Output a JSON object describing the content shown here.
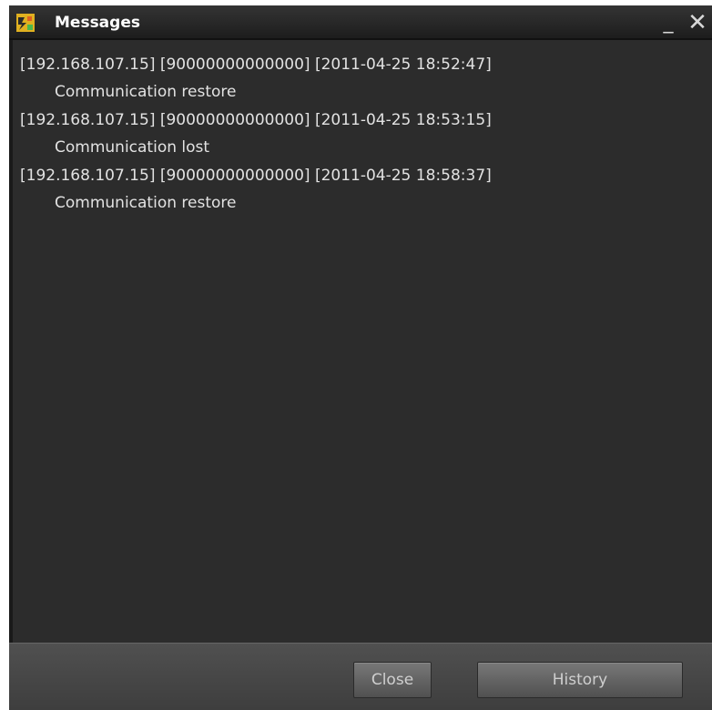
{
  "window": {
    "title": "Messages",
    "minimize_glyph": "_",
    "close_glyph": "✕",
    "icon": "app-icon"
  },
  "messages": [
    {
      "header": "[192.168.107.15] [90000000000000] [2011-04-25 18:52:47]",
      "text": "Communication restore"
    },
    {
      "header": "[192.168.107.15] [90000000000000] [2011-04-25 18:53:15]",
      "text": "Communication lost"
    },
    {
      "header": "[192.168.107.15] [90000000000000] [2011-04-25 18:58:37]",
      "text": "Communication restore"
    }
  ],
  "footer": {
    "close_label": "Close",
    "history_label": "History"
  },
  "colors": {
    "background": "#2c2c2c",
    "titlebar": "#1d1d1d",
    "text": "#e2e2e2",
    "button": "#606060"
  }
}
